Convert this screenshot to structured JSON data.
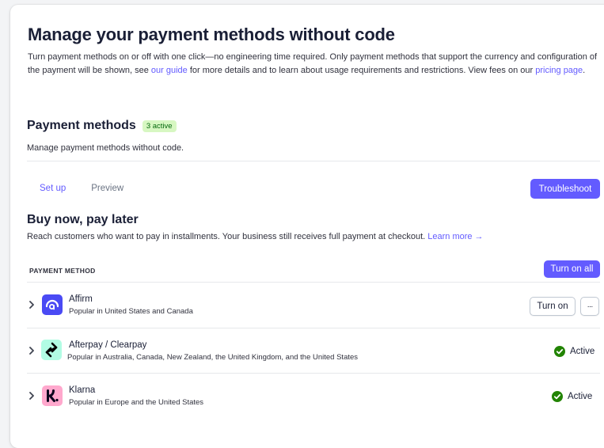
{
  "hero": {
    "title": "Manage your payment methods without code",
    "desc_1": "Turn payment methods on or off with one click—no engineering time required. Only payment methods that support the currency and configuration of the payment will be shown, see ",
    "guide_link": "our guide",
    "desc_2": " for more details and to learn about usage requirements and restrictions. View fees on our ",
    "pricing_link": "pricing page",
    "desc_3": "."
  },
  "payment_methods": {
    "title": "Payment methods",
    "badge": "3 active",
    "subtitle": "Manage payment methods without code."
  },
  "tabs": [
    {
      "label": "Set up"
    },
    {
      "label": "Preview"
    }
  ],
  "troubleshoot_label": "Troubleshoot",
  "bnpl": {
    "title": "Buy now, pay later",
    "desc": "Reach customers who want to pay in installments. Your business still receives full payment at checkout. ",
    "learn_more": "Learn more →"
  },
  "table": {
    "column_header": "PAYMENT METHOD",
    "turn_on_all_label": "Turn on all"
  },
  "methods": [
    {
      "name": "Affirm",
      "desc": "Popular in United States and Canada",
      "action_label": "Turn on",
      "more_label": "···"
    },
    {
      "name": "Afterpay / Clearpay",
      "desc": "Popular in Australia, Canada, New Zealand, the United Kingdom, and the United States",
      "status": "Active"
    },
    {
      "name": "Klarna",
      "desc": "Popular in Europe and the United States",
      "status": "Active"
    }
  ],
  "colors": {
    "accent": "#635bff",
    "active_green": "#228403",
    "badge_bg": "#d7f7c2",
    "affirm_logo": "#4a4af4",
    "afterpay_logo": "#b2fce4",
    "klarna_logo": "#ffa8cd"
  }
}
